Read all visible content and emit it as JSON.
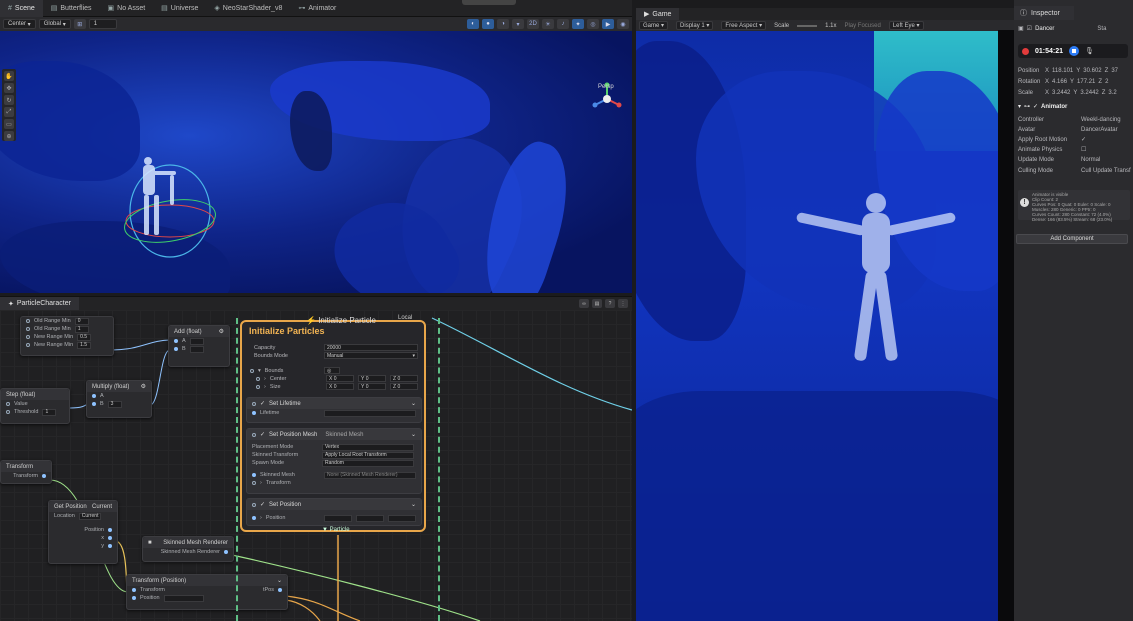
{
  "top_tabs": [
    {
      "label": "Scene",
      "icon": "grid-icon"
    },
    {
      "label": "Butterflies",
      "icon": "folder-icon"
    },
    {
      "label": "No Asset",
      "icon": "cube-icon"
    },
    {
      "label": "Universe",
      "icon": "folder-icon"
    },
    {
      "label": "NeoStarShader_v8",
      "icon": "shader-icon"
    },
    {
      "label": "Animator",
      "icon": "animator-icon"
    }
  ],
  "scene_toolbar": {
    "pivot": "Center",
    "space": "Global",
    "snap": "1"
  },
  "scene_view": {
    "camera_label": "Persp",
    "colors": {
      "accent": "#2d5d9a",
      "scene_blue": "#1f48c9"
    }
  },
  "graph": {
    "tab_label": "ParticleCharacter",
    "remap_rows": [
      "Old Range Min",
      "Old Range Min",
      "New Range Min",
      "New Range Min"
    ],
    "remap_values": [
      "0",
      "1",
      "0.5",
      "1.5"
    ],
    "add_node": "Add (float)",
    "step_node": {
      "title": "Step (float)",
      "rows": [
        "Value",
        "Threshold"
      ],
      "threshold_value": "1"
    },
    "multiply_node": {
      "title": "Multiply (float)",
      "b_value": "3"
    },
    "transform_node": {
      "title": "Transform",
      "row": "Transform"
    },
    "get_position": {
      "title": "Get Position",
      "mode": "Current",
      "location_label": "Location",
      "location": "Current",
      "out": "Position"
    },
    "skinned_node": {
      "title": "Skinned Mesh Renderer",
      "out": "Skinned Mesh Renderer"
    },
    "transform_position": {
      "title": "Transform (Position)",
      "rows": [
        "Transform",
        "Position"
      ],
      "out": "tPos"
    },
    "context": {
      "topbar": "Initialize Particle",
      "local_label": "Local",
      "title": "Initialize Particles",
      "capacity_label": "Capacity",
      "capacity": "20000",
      "bounds_mode_label": "Bounds Mode",
      "bounds_mode": "Manual",
      "bounds_label": "Bounds",
      "center_label": "Center",
      "size_label": "Size",
      "vec": [
        "X",
        "0",
        "Y",
        "0",
        "Z",
        "0"
      ],
      "lifetime_block": "Set Lifetime",
      "lifetime_label": "Lifetime",
      "posmesh_block": "Set Position Mesh",
      "posmesh_mode": "Skinned Mesh",
      "placement_label": "Placement Mode",
      "placement": "Vertex",
      "skinned_transform_label": "Skinned Transform",
      "skinned_transform": "Apply Local Root Transform",
      "spawn_label": "Spawn Mode",
      "spawn": "Random",
      "skinned_mesh_label": "Skinned Mesh",
      "skinned_mesh": "None (Skinned Mesh Renderer)",
      "transform_label": "Transform",
      "position_block": "Set Position",
      "position_label": "Position",
      "footer": "Particle"
    }
  },
  "game": {
    "tab_label": "Game",
    "mode": "Game",
    "display": "Display 1",
    "aspect": "Free Aspect",
    "scale_label": "Scale",
    "scale": "1.1x",
    "play_focused": "Play Focused",
    "eye": "Left Eye"
  },
  "inspector": {
    "tab_label": "Inspector",
    "object_name": "Dancer",
    "static_label": "Sta",
    "record_time": "01:54:21",
    "position_label": "Position",
    "position": [
      "X",
      "118.101",
      "Y",
      "30.602",
      "Z",
      "37"
    ],
    "rotation_label": "Rotation",
    "rotation": [
      "X",
      "4.166",
      "Y",
      "177.21",
      "Z",
      "2"
    ],
    "scale_label": "Scale",
    "scale": [
      "X",
      "3.2442",
      "Y",
      "3.2442",
      "Z",
      "3.2"
    ],
    "animator_title": "Animator",
    "controller_label": "Controller",
    "controller": "Weekl-dancing",
    "avatar_label": "Avatar",
    "avatar": "DancerAvatar",
    "root_motion_label": "Apply Root Motion",
    "animate_physics_label": "Animate Physics",
    "update_mode_label": "Update Mode",
    "update_mode": "Normal",
    "culling_label": "Culling Mode",
    "culling": "Cull Update Transf",
    "info_lines": [
      "Animator is visible",
      "Clip Count: 2",
      "Curves Pos: 0 Quat: 0 Euler: 0 Scale: 0",
      "Muscles: 280 Generic: 0 PPtr: 0",
      "Curves Count: 280 Constant: 72 (4.0%)",
      "Dense: 166 (83.5%) Stream: 68 (23.0%)"
    ],
    "add_component": "Add Component"
  }
}
